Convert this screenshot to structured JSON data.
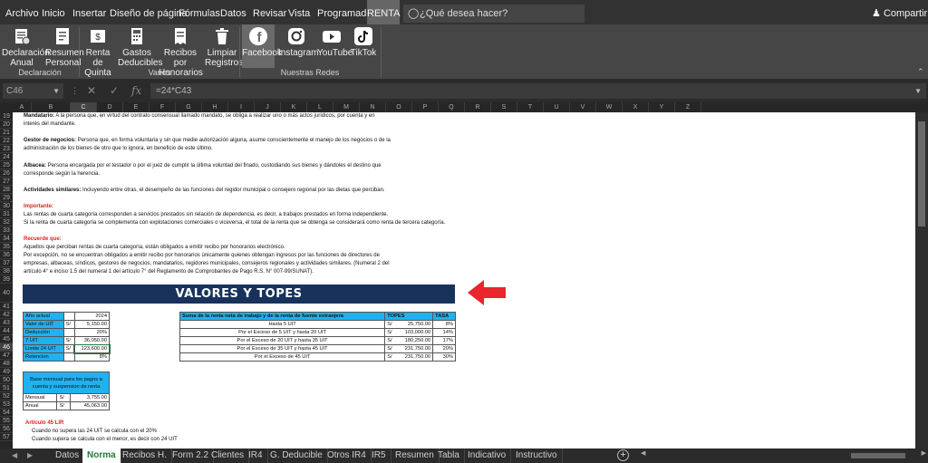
{
  "menu": {
    "tabs": [
      "Archivo",
      "Inicio",
      "Insertar",
      "Diseño de página",
      "Fórmulas",
      "Datos",
      "Revisar",
      "Vista",
      "Programador",
      "RENTA"
    ],
    "active_tab": "RENTA",
    "tell_me": "¿Qué desea hacer?",
    "share": "Compartir"
  },
  "ribbon": {
    "buttons": [
      {
        "l1": "Declaración",
        "l2": "Anual",
        "icon": "declaration-icon"
      },
      {
        "l1": "Resumen",
        "l2": "Personal",
        "icon": "summary-icon"
      },
      {
        "l1": "Renta de",
        "l2": "Quinta",
        "icon": "salary-icon"
      },
      {
        "l1": "Gastos",
        "l2": "Deducibles",
        "icon": "calculator-icon"
      },
      {
        "l1": "Recibos por",
        "l2": "Honorarios",
        "icon": "receipt-icon"
      },
      {
        "l1": "Limpiar",
        "l2": "Registros",
        "icon": "trash-icon"
      },
      {
        "l1": "Facebook",
        "l2": "",
        "icon": "facebook-icon"
      },
      {
        "l1": "Instagram",
        "l2": "",
        "icon": "instagram-icon"
      },
      {
        "l1": "YouTube",
        "l2": "",
        "icon": "youtube-icon"
      },
      {
        "l1": "TikTok",
        "l2": "",
        "icon": "tiktok-icon"
      }
    ],
    "groups": [
      "Declaración",
      "Varios",
      "Nuestras Redes"
    ]
  },
  "formula_bar": {
    "name_box": "C46",
    "fx": "fx",
    "formula": "=24*C43"
  },
  "columns": [
    "A",
    "B",
    "C",
    "D",
    "E",
    "F",
    "G",
    "H",
    "I",
    "J",
    "K",
    "L",
    "M",
    "N",
    "O",
    "P",
    "Q",
    "R",
    "S",
    "T",
    "U",
    "V",
    "W",
    "X",
    "Y",
    "Z"
  ],
  "rows": [
    "19",
    "20",
    "21",
    "22",
    "23",
    "24",
    "25",
    "26",
    "27",
    "28",
    "29",
    "30",
    "31",
    "32",
    "33",
    "34",
    "35",
    "36",
    "37",
    "38",
    "39",
    "40",
    "41",
    "42",
    "43",
    "44",
    "45",
    "46",
    "47",
    "48",
    "49",
    "50",
    "51",
    "52",
    "53",
    "54",
    "55",
    "56",
    "57"
  ],
  "selected": {
    "column": "C",
    "row": "46"
  },
  "text": {
    "mandatario_label": "Mandatario:",
    "mandatario_1": " A la persona que, en virtud del contrato consensual llamado mandato, se obliga a realizar uno o más actos jurídicos, por cuenta y en",
    "mandatario_2": "interés del mandante.",
    "gestor_label": "Gestor de negocios:",
    "gestor_1": " Persona que, en forma voluntaria y sin que medie autorización alguna, asume conscientemente el manejo de los negocios o de la",
    "gestor_2": "administración de los bienes de otro que lo ignora, en beneficio de este último.",
    "albacea_label": "Albacea:",
    "albacea_1": " Persona encargada por el testador o por el juez de cumplir la última voluntad del finado, custodiando sus bienes y dándoles el destino que",
    "albacea_2": "corresponde según la herencia.",
    "actividades_label": "Actividades similares:",
    "actividades_1": " Incluyendo entre otras, el desempeño de las funciones del regidor municipal o consejero regional por las dietas que perciban.",
    "importante_label": "Importante:",
    "importante_1": "Las rentas de cuarta categoría corresponden a servicios prestados sin relación de dependencia, es decir, a trabajos prestados en forma independiente.",
    "importante_2": "Si la renta de cuarta categoría se complementa con explotaciones comerciales o viceversa, el total de la renta que se obtenga se considerará como renta de tercera categoría.",
    "recuerde_label": "Recuerde que:",
    "recuerde_1": "Aquellos que perciban rentas de cuarta categoría, están obligados a emitir recibo por honorarios electrónico.",
    "recuerde_2": "Por excepción, no se encuentran obligados a emitir recibo por honorarios únicamente quienes obtengan ingresos por las funciones de directores de",
    "recuerde_3": "empresas, albaceas, síndicos, gestores de negocios, mandatarios, regidores municipales, consejeros regionales y actividades similares. (Numeral 2 del",
    "recuerde_4": "artículo 4° e inciso 1.5 del numeral 1 del artículo 7° del Reglamento de Comprobantes de Pago R.S. N° 007-99/SUNAT).",
    "banner": "VALORES Y TOPES",
    "articulo_label": "Artículo 45 LIR",
    "articulo_1": "Cuando no supera las 24 UIT se calcula con el 20%",
    "articulo_2": "Cuando supera se calcula con el menor, es decir con 24 UIT"
  },
  "params": [
    {
      "label": "Año actual",
      "cur": "",
      "value": "2024"
    },
    {
      "label": "Valor de UIT",
      "cur": "S/",
      "value": "5,150.00"
    },
    {
      "label": "Deducción",
      "cur": "",
      "value": "20%"
    },
    {
      "label": "7 UIT",
      "cur": "S/",
      "value": "36,050.00"
    },
    {
      "label": "Limite 24 UIT",
      "cur": "S/",
      "value": "123,600.00"
    },
    {
      "label": "Retencion",
      "cur": "",
      "value": "8%"
    }
  ],
  "base": {
    "header_1": "Base mensual para los pagos a",
    "header_2": "cuenta y suspension de renta",
    "rows": [
      {
        "label": "Mensual",
        "cur": "S/",
        "value": "3,755.00"
      },
      {
        "label": "Anual",
        "cur": "S/",
        "value": "45,063.00"
      }
    ]
  },
  "topes": {
    "headers": [
      "Suma de la renta neta de trabajo y de la renta de fuente extranjera",
      "TOPES",
      "TASA"
    ],
    "rows": [
      {
        "label": "Hasta 5 UIT",
        "cur": "S/",
        "value": "25,750.00",
        "rate": "8%"
      },
      {
        "label": "Por el Exceso de 5 UIT y hasta 20 UIT",
        "cur": "S/",
        "value": "103,000.00",
        "rate": "14%"
      },
      {
        "label": "Por el Exceso de 20 UIT y hasta 35 UIT",
        "cur": "S/",
        "value": "180,250.00",
        "rate": "17%"
      },
      {
        "label": "Por el Exceso de 35 UIT y hasta 45 UIT",
        "cur": "S/",
        "value": "231,750.00",
        "rate": "20%"
      },
      {
        "label": "Por el Exceso de 45 UIT",
        "cur": "S/",
        "value": "231,750.00",
        "rate": "30%"
      }
    ]
  },
  "sheet_tabs": [
    "Datos",
    "Norma",
    "Recibos H.",
    "Form 2.2",
    "Clientes",
    "IR4",
    "G. Deducible",
    "Otros IR4",
    "IR5",
    "Resumen",
    "Tabla",
    "Indicativo",
    "Instructivo"
  ],
  "active_sheet": "Norma",
  "add_sheet": "+",
  "colors": {
    "banner": "#17335c",
    "cyan": "#21b1ee",
    "red": "#e02020",
    "active_tab_text": "#1f7a3a"
  }
}
